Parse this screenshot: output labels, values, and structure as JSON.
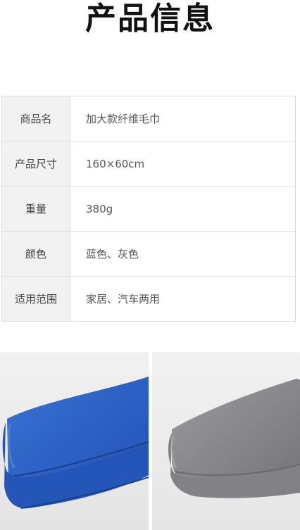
{
  "header": {
    "title": "产品信息"
  },
  "specs": [
    {
      "label": "商品名",
      "value": "加大款纤维毛巾"
    },
    {
      "label": "产品尺寸",
      "value": "160×60cm"
    },
    {
      "label": "重量",
      "value": "380g"
    },
    {
      "label": "颜色",
      "value": "蓝色、灰色"
    },
    {
      "label": "适用范围",
      "value": "家居、汽车两用"
    }
  ],
  "photos": [
    {
      "name": "blue-towel",
      "color": "#2a5fc4"
    },
    {
      "name": "gray-towel",
      "color": "#8a8a8e"
    }
  ]
}
